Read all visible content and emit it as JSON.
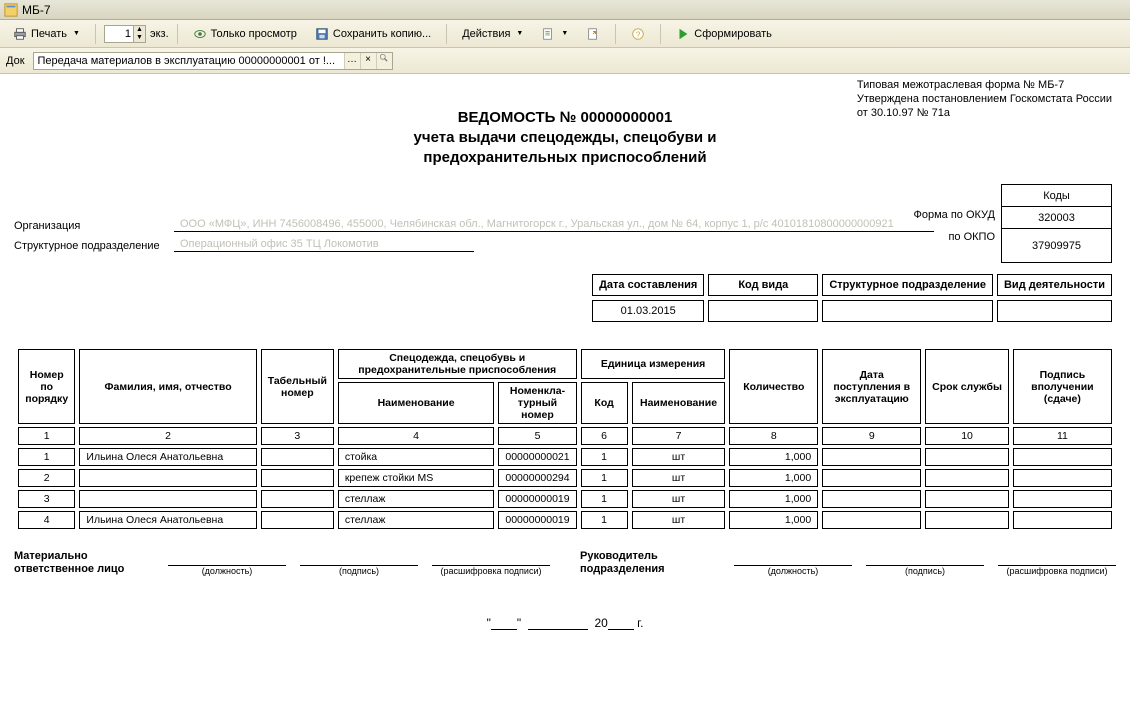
{
  "window": {
    "title": "МБ-7"
  },
  "toolbar": {
    "print": "Печать",
    "copies_value": "1",
    "copies_label": "экз.",
    "view_only": "Только просмотр",
    "save_copy": "Сохранить копию...",
    "actions": "Действия",
    "generate": "Сформировать"
  },
  "docbar": {
    "label": "Док",
    "value": "Передача материалов в эксплуатацию 00000000001 от !..."
  },
  "header_right": {
    "l1": "Типовая межотраслевая форма № МБ-7",
    "l2": "Утверждена постановлением Госкомстата России",
    "l3": "от 30.10.97 № 71а"
  },
  "title": {
    "l1": "ВЕДОМОСТЬ № 00000000001",
    "l2": "учета выдачи спецодежды, спецобуви и",
    "l3": "предохранительных приспособлений"
  },
  "codes": {
    "header": "Коды",
    "okud_label": "Форма по ОКУД",
    "okud": "320003",
    "okpo_label": "по ОКПО",
    "okpo": "37909975"
  },
  "org": {
    "org_label": "Организация",
    "org_value": "ООО «МФЦ», ИНН 7456008496, 455000, Челябинская обл., Магнитогорск г., Уральская ул., дом № 64, корпус 1, р/с 40101810800000000921",
    "dept_label": "Структурное подразделение",
    "dept_value": "Операционный офис 35  ТЦ Локомотив"
  },
  "meta": {
    "h1": "Дата составления",
    "h2": "Код вида",
    "h3": "Структурное подразделение",
    "h4": "Вид деятельности",
    "date": "01.03.2015",
    "code": "",
    "dept": "",
    "activity": ""
  },
  "columns": {
    "c1": "Номер по порядку",
    "c2": "Фамилия, имя, отчество",
    "c3": "Табельный номер",
    "g_spec": "Спецодежда, спецобувь и предохранительные приспособления",
    "c4": "Наименование",
    "c5": "Номенкла-турный номер",
    "g_unit": "Единица измерения",
    "c6": "Код",
    "c7": "Наименование",
    "c8": "Количество",
    "c9": "Дата поступления в эксплуатацию",
    "c10": "Срок службы",
    "c11": "Подпись вполучении (сдаче)",
    "n1": "1",
    "n2": "2",
    "n3": "3",
    "n4": "4",
    "n5": "5",
    "n6": "6",
    "n7": "7",
    "n8": "8",
    "n9": "9",
    "n10": "10",
    "n11": "11"
  },
  "rows": [
    {
      "n": "1",
      "fio": "Ильина Олеся Анатольевна",
      "tab": "",
      "item": "стойка",
      "nomen": "00000000021",
      "ucode": "1",
      "uname": "шт",
      "qty": "1,000",
      "date": "",
      "life": "",
      "sign": ""
    },
    {
      "n": "2",
      "fio": "",
      "tab": "",
      "item": "крепеж стойки MS",
      "nomen": "00000000294",
      "ucode": "1",
      "uname": "шт",
      "qty": "1,000",
      "date": "",
      "life": "",
      "sign": ""
    },
    {
      "n": "3",
      "fio": "",
      "tab": "",
      "item": "стеллаж",
      "nomen": "00000000019",
      "ucode": "1",
      "uname": "шт",
      "qty": "1,000",
      "date": "",
      "life": "",
      "sign": ""
    },
    {
      "n": "4",
      "fio": "Ильина Олеся Анатольевна",
      "tab": "",
      "item": "стеллаж",
      "nomen": "00000000019",
      "ucode": "1",
      "uname": "шт",
      "qty": "1,000",
      "date": "",
      "life": "",
      "sign": ""
    }
  ],
  "sign": {
    "left_label": "Материально ответственное лицо",
    "right_label": "Руководитель подразделения",
    "cap_post": "(должность)",
    "cap_sign": "(подпись)",
    "cap_name": "(расшифровка подписи)"
  },
  "dateline": {
    "quote1": "\"",
    "quote2": "\"",
    "year_prefix": "20",
    "year_suffix": "г."
  }
}
